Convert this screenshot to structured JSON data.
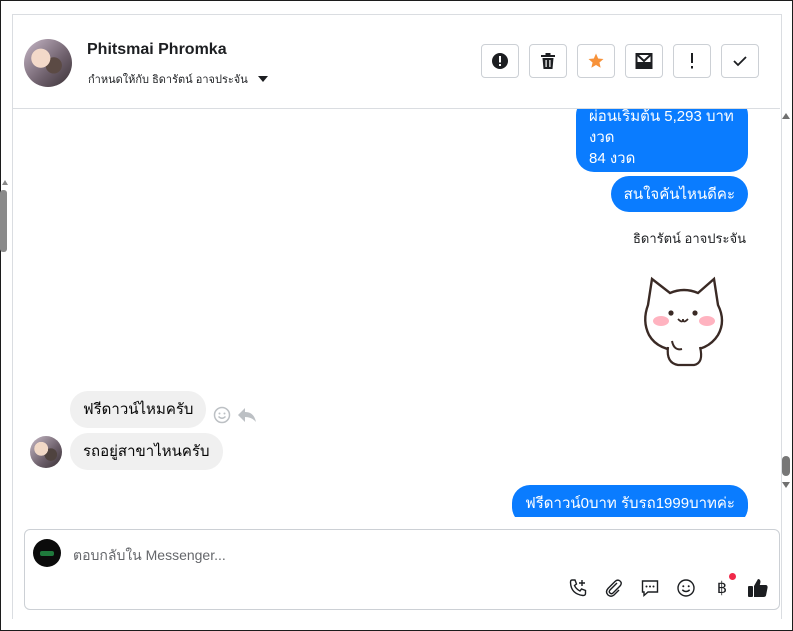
{
  "header": {
    "contact_name": "Phitsmai Phromka",
    "assigned_to": "กำหนดให้กับ ธิดารัตน์ อาจประจัน"
  },
  "toolbar": {
    "buttons": [
      {
        "name": "spam",
        "icon": "alert-circle-icon"
      },
      {
        "name": "delete",
        "icon": "trash-icon"
      },
      {
        "name": "star",
        "icon": "star-icon",
        "color": "#f7923a"
      },
      {
        "name": "move-to-inbox",
        "icon": "mail-icon"
      },
      {
        "name": "follow-up",
        "icon": "exclamation-icon"
      },
      {
        "name": "done",
        "icon": "check-icon"
      }
    ]
  },
  "messages": {
    "out_partial": "ผ่อนเริ่มต้น 5,293 บาท งวด",
    "out_partial_line2": "84 งวด",
    "out_interest": "สนใจคันไหนดีคะ",
    "sender_name": "ธิดารัตน์ อาจประจัน",
    "in_free_down": "ฟรีดาวน์ไหมครับ",
    "in_branch": "รถอยู่สาขาไหนครับ",
    "out_free_down": "ฟรีดาวน์0บาท รับรถ1999บาทค่ะ"
  },
  "composer": {
    "placeholder": "ตอบกลับใน Messenger...",
    "currency_symbol": "฿"
  },
  "colors": {
    "outgoing_bubble": "#0a7cff",
    "incoming_bubble": "#f0f0f0",
    "star_accent": "#f7923a",
    "notification_dot": "#f02849"
  }
}
